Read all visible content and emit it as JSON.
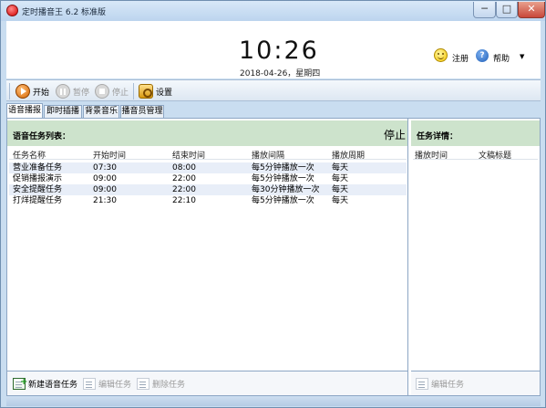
{
  "window": {
    "title": "定时播音王 6.2 标准版",
    "controls": {
      "minimize": "─",
      "maximize": "□",
      "close": "✕"
    }
  },
  "clock": {
    "time": "10:26",
    "date": "2018-04-26，星期四"
  },
  "header_links": {
    "register": "注册",
    "help": "帮助",
    "help_menu_arrow": "▼"
  },
  "toolbar": {
    "start": "开始",
    "pause": "暂停",
    "stop": "停止",
    "settings": "设置"
  },
  "tabs": [
    {
      "label": "语音播报",
      "active": true
    },
    {
      "label": "即时插播",
      "active": false
    },
    {
      "label": "背景音乐",
      "active": false
    },
    {
      "label": "播音员管理",
      "active": false
    }
  ],
  "task_list": {
    "title": "语音任务列表：",
    "status": "停止",
    "columns": [
      "任务名称",
      "开始时间",
      "结束时间",
      "播放间隔",
      "播放周期"
    ],
    "rows": [
      [
        "营业准备任务",
        "07:30",
        "08:00",
        "每5分钟播放一次",
        "每天"
      ],
      [
        "促销播报演示",
        "09:00",
        "22:00",
        "每5分钟播放一次",
        "每天"
      ],
      [
        "安全提醒任务",
        "09:00",
        "22:00",
        "每30分钟播放一次",
        "每天"
      ],
      [
        "打烊提醒任务",
        "21:30",
        "22:10",
        "每5分钟播放一次",
        "每天"
      ]
    ],
    "buttons": {
      "new_task": "新建语音任务",
      "edit_task": "编辑任务",
      "delete_task": "删除任务"
    }
  },
  "task_detail": {
    "title": "任务详情：",
    "columns": [
      "播放时间",
      "文稿标题"
    ],
    "buttons": {
      "edit_task": "编辑任务"
    }
  },
  "colors": {
    "header_green": "#cde3cc",
    "alt_row": "#e8eef8",
    "window_blue": "#c9ddf0"
  }
}
